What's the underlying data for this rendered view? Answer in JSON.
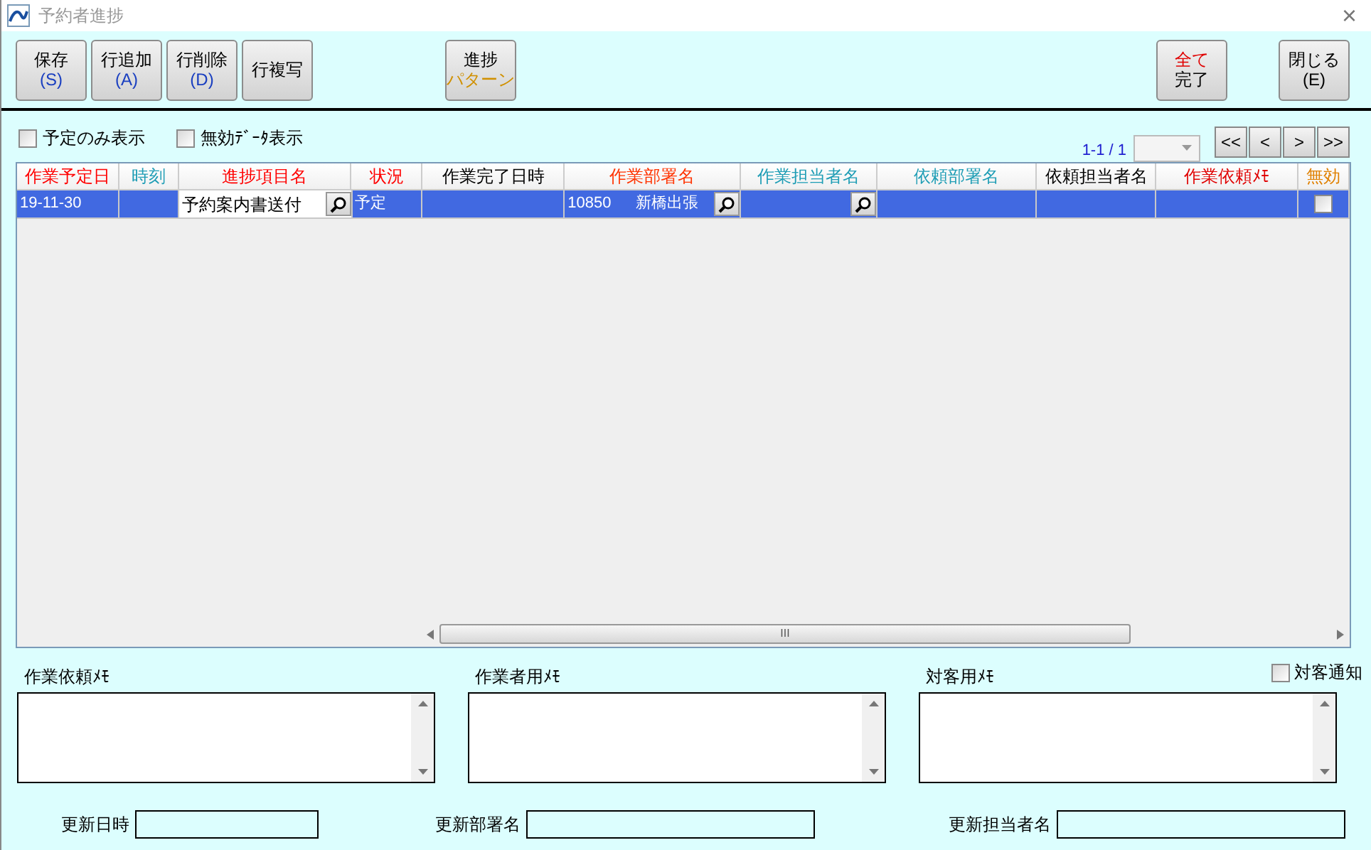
{
  "window": {
    "title": "予約者進捗",
    "close": "×"
  },
  "toolbar": {
    "left": [
      {
        "lines": [
          {
            "text": "保存",
            "color": "#000000"
          },
          {
            "text": "(S)",
            "color": "#1a3fc0"
          }
        ]
      },
      {
        "lines": [
          {
            "text": "行追加",
            "color": "#000000"
          },
          {
            "text": "(A)",
            "color": "#1a3fc0"
          }
        ]
      },
      {
        "lines": [
          {
            "text": "行削除",
            "color": "#000000"
          },
          {
            "text": "(D)",
            "color": "#1a3fc0"
          }
        ]
      },
      {
        "lines": [
          {
            "text": "行複写",
            "color": "#000000"
          }
        ]
      }
    ],
    "middle": [
      {
        "lines": [
          {
            "text": "進捗",
            "color": "#000000"
          },
          {
            "text": "パターン",
            "color": "#d09000"
          }
        ]
      }
    ],
    "right": [
      {
        "lines": [
          {
            "text": "全て",
            "color": "#e00000"
          },
          {
            "text": "完了",
            "color": "#000000"
          }
        ]
      },
      {
        "lines": [
          {
            "text": "閉じる",
            "color": "#000000"
          },
          {
            "text": "(E)",
            "color": "#000000"
          }
        ]
      }
    ]
  },
  "filters": [
    {
      "label": "予定のみ表示",
      "checked": false
    },
    {
      "label": "無効ﾃﾞｰﾀ表示",
      "checked": false
    }
  ],
  "pager": {
    "range": "1-1 / 1",
    "buttons": [
      "<<",
      "<",
      ">",
      ">>"
    ]
  },
  "table": {
    "columns": [
      {
        "label": "作業予定日",
        "color": "#ff0000"
      },
      {
        "label": "時刻",
        "color": "#1e9db5"
      },
      {
        "label": "進捗項目名",
        "color": "#ff0000"
      },
      {
        "label": "状況",
        "color": "#ff0000"
      },
      {
        "label": "作業完了日時",
        "color": "#000000"
      },
      {
        "label": "作業部署名",
        "color": "#ff3300"
      },
      {
        "label": "作業担当者名",
        "color": "#1e9db5"
      },
      {
        "label": "依頼部署名",
        "color": "#1e9db5"
      },
      {
        "label": "依頼担当者名",
        "color": "#000000"
      },
      {
        "label": "作業依頼ﾒﾓ",
        "color": "#e00000"
      },
      {
        "label": "無効",
        "color": "#e08000"
      }
    ],
    "rows": [
      {
        "selected": true,
        "cells": [
          {
            "kind": "text",
            "text": "19-11-30"
          },
          {
            "kind": "text",
            "text": ""
          },
          {
            "kind": "lookup",
            "text": "予約案内書送付",
            "editing": true
          },
          {
            "kind": "text",
            "text": "予定"
          },
          {
            "kind": "text",
            "text": ""
          },
          {
            "kind": "lookup",
            "code": "10850",
            "text": "新橋出張",
            "editing": false
          },
          {
            "kind": "lookup",
            "text": "",
            "editing": false
          },
          {
            "kind": "text",
            "text": ""
          },
          {
            "kind": "text",
            "text": ""
          },
          {
            "kind": "text",
            "text": ""
          },
          {
            "kind": "checkbox",
            "checked": false
          }
        ]
      }
    ],
    "scroll_thumb": "III"
  },
  "memos": [
    {
      "label": "作業依頼ﾒﾓ"
    },
    {
      "label": "作業者用ﾒﾓ"
    },
    {
      "label": "対客用ﾒﾓ"
    }
  ],
  "notify": {
    "label": "対客通知",
    "checked": false
  },
  "footer": [
    {
      "label": "更新日時"
    },
    {
      "label": "更新部署名"
    },
    {
      "label": "更新担当者名"
    }
  ]
}
